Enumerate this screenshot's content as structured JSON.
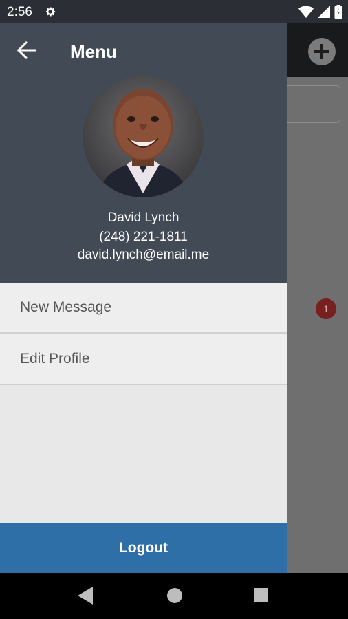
{
  "status_bar": {
    "time": "2:56"
  },
  "drawer": {
    "title": "Menu",
    "profile": {
      "name": "David Lynch",
      "phone": "(248) 221-1811",
      "email": "david.lynch@email.me"
    },
    "items": [
      {
        "label": "New Message"
      },
      {
        "label": "Edit Profile"
      }
    ],
    "logout_label": "Logout"
  },
  "background": {
    "badge_count": "1"
  },
  "colors": {
    "header_bg": "#414a55",
    "logout_bg": "#2e6fa8",
    "drawer_bg": "#e8e8e8",
    "badge_bg": "#7a1f1f"
  },
  "icons": {
    "back": "arrow-left-icon",
    "settings": "gear-icon",
    "wifi": "wifi-icon",
    "signal": "signal-icon",
    "battery": "battery-icon",
    "add": "plus-icon"
  }
}
